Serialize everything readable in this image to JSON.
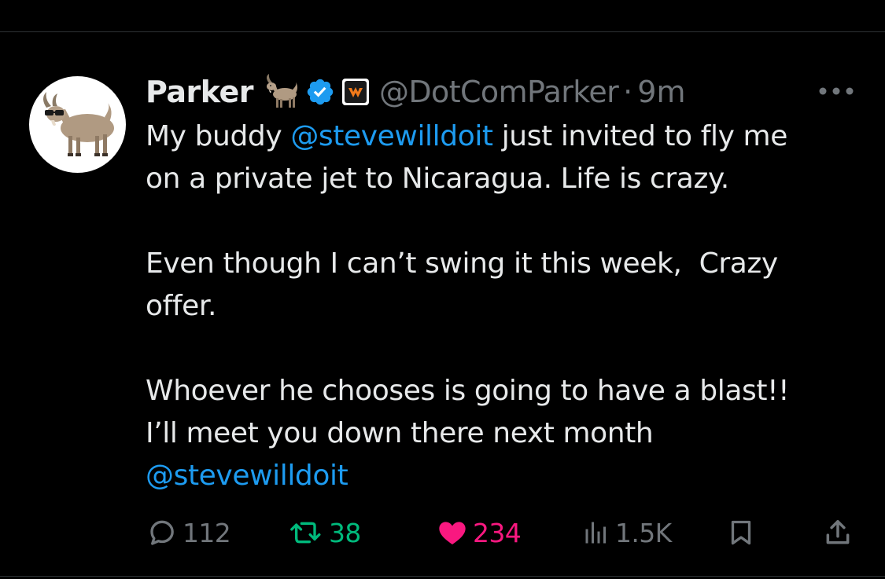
{
  "tweet": {
    "display_name": "Parker",
    "handle": "@DotComParker",
    "separator": "·",
    "time": "9m",
    "avatar_icon": "goat-with-sunglasses-icon",
    "name_emoji_icon": "goat-icon",
    "verified_icon": "verified-badge-icon",
    "affiliate_icon": "affiliate-badge-icon",
    "body": {
      "p1_prefix": "My buddy ",
      "p1_mention": "@stevewilldoit",
      "p1_line1_suffix": " just invited to fly me",
      "p1_line2": "on a private jet to Nicaragua. Life is crazy.",
      "p2_line1": "Even though I can’t swing it this week,  Crazy",
      "p2_line2": "offer.",
      "p3_line1": "Whoever he chooses is going to have a blast!!",
      "p3_line2": "I’ll meet you down there next month",
      "p3_mention": "@stevewilldoit"
    }
  },
  "actions": {
    "reply_count": "112",
    "retweet_count": "38",
    "like_count": "234",
    "views_count": "1.5K",
    "reply_icon": "reply-bubble-icon",
    "retweet_icon": "retweet-icon",
    "like_icon": "heart-filled-icon",
    "views_icon": "views-chart-icon",
    "bookmark_icon": "bookmark-icon",
    "share_icon": "share-icon"
  },
  "colors": {
    "background": "#000000",
    "text_primary": "#e7e9ea",
    "text_secondary": "#71767b",
    "link": "#1d9bf0",
    "retweet_active": "#00ba7c",
    "like_active": "#f91880",
    "divider": "#2f3336"
  }
}
